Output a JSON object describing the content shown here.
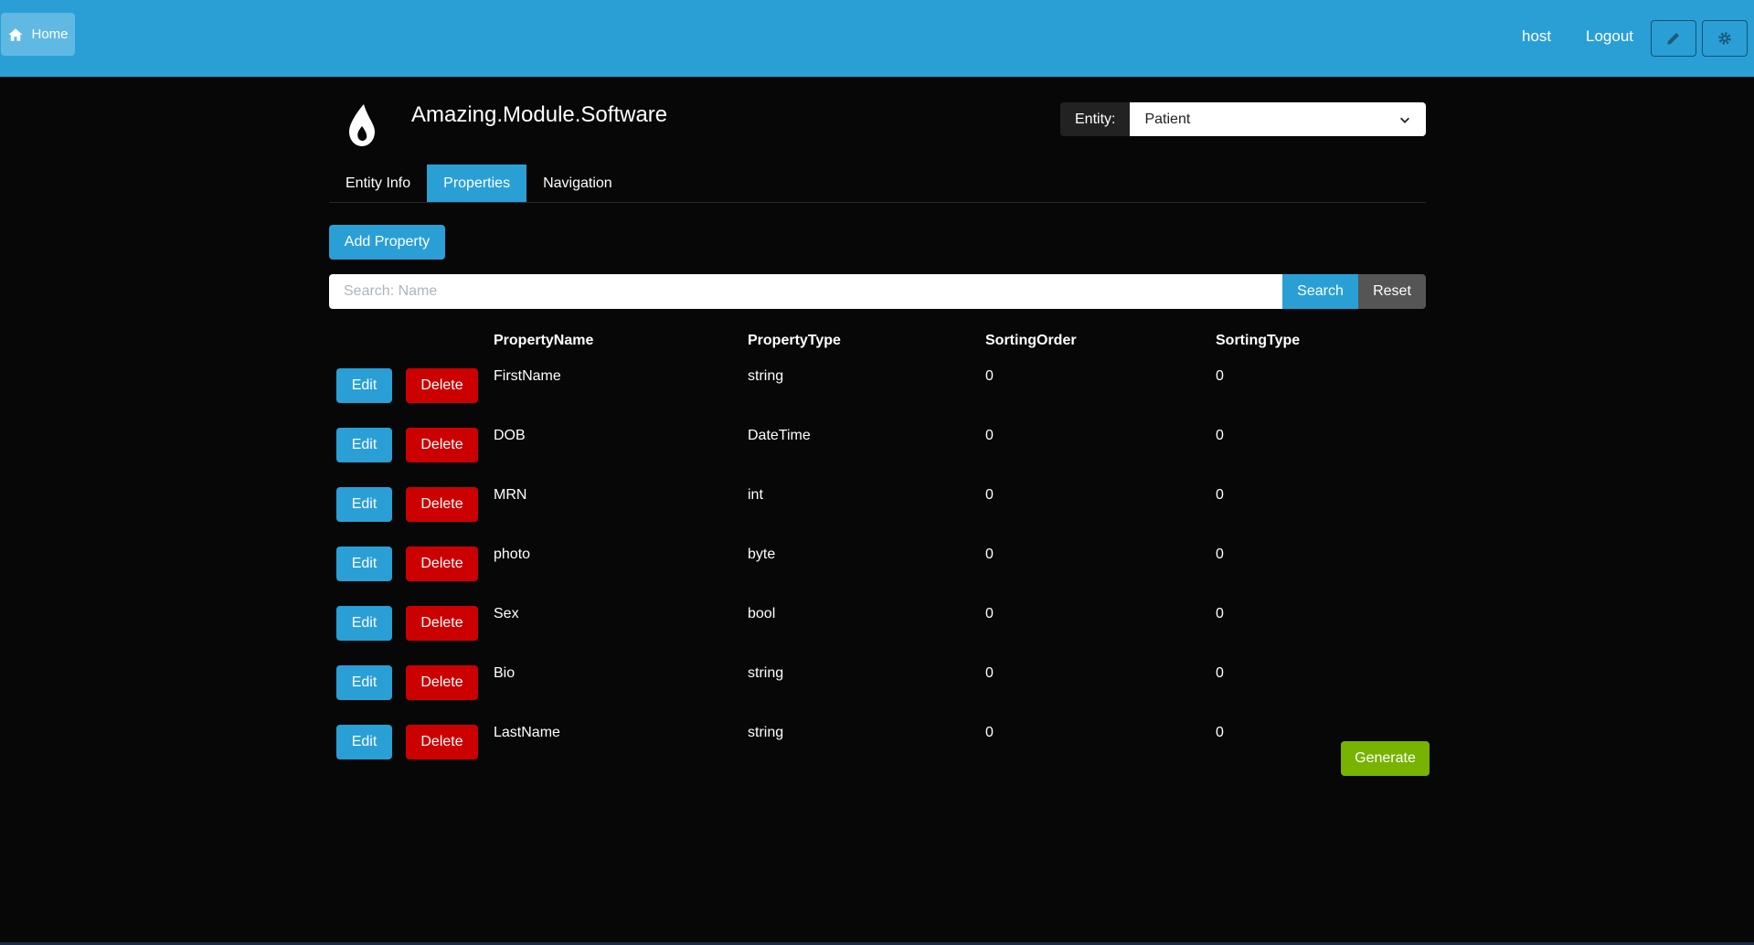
{
  "topbar": {
    "home_label": "Home",
    "user": "host",
    "logout_label": "Logout",
    "bg_color": "#2a9fd6"
  },
  "app": {
    "title": "Amazing.Module.Software",
    "logo_icon": "droplet-logo-icon"
  },
  "entity": {
    "label": "Entity:",
    "selected": "Patient"
  },
  "tabs": [
    {
      "label": "Entity Info",
      "active": false
    },
    {
      "label": "Properties",
      "active": true
    },
    {
      "label": "Navigation",
      "active": false
    }
  ],
  "add_property_label": "Add Property",
  "search": {
    "placeholder": "Search: Name",
    "search_label": "Search",
    "reset_label": "Reset"
  },
  "table": {
    "columns": [
      "PropertyName",
      "PropertyType",
      "SortingOrder",
      "SortingType"
    ],
    "edit_label": "Edit",
    "delete_label": "Delete",
    "rows": [
      {
        "name": "FirstName",
        "type": "string",
        "order": "0",
        "sorting_type": "0"
      },
      {
        "name": "DOB",
        "type": "DateTime",
        "order": "0",
        "sorting_type": "0"
      },
      {
        "name": "MRN",
        "type": "int",
        "order": "0",
        "sorting_type": "0"
      },
      {
        "name": "photo",
        "type": "byte",
        "order": "0",
        "sorting_type": "0"
      },
      {
        "name": "Sex",
        "type": "bool",
        "order": "0",
        "sorting_type": "0"
      },
      {
        "name": "Bio",
        "type": "string",
        "order": "0",
        "sorting_type": "0"
      },
      {
        "name": "LastName",
        "type": "string",
        "order": "0",
        "sorting_type": "0"
      }
    ]
  },
  "generate_label": "Generate",
  "colors": {
    "primary": "#2a9fd6",
    "danger": "#cc0000",
    "success": "#77b300",
    "secondary": "#555555",
    "background": "#070707"
  }
}
